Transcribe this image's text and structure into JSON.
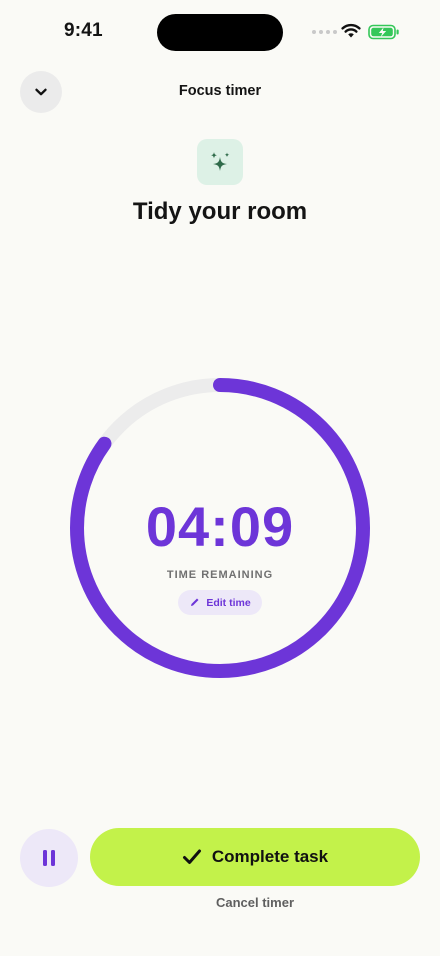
{
  "status_bar": {
    "time": "9:41"
  },
  "header": {
    "title": "Focus timer"
  },
  "task": {
    "title": "Tidy your room",
    "icon": "sparkles-icon"
  },
  "timer": {
    "remaining": "04:09",
    "label": "TIME REMAINING",
    "edit_label": "Edit time",
    "progress_remaining_fraction": 0.85
  },
  "actions": {
    "complete_label": "Complete task",
    "cancel_label": "Cancel timer"
  },
  "colors": {
    "accent": "#6d35d8",
    "primary_button": "#c3f24a",
    "track": "#ececec",
    "icon_bg": "#ddf1e6",
    "icon": "#2f6b4a"
  }
}
